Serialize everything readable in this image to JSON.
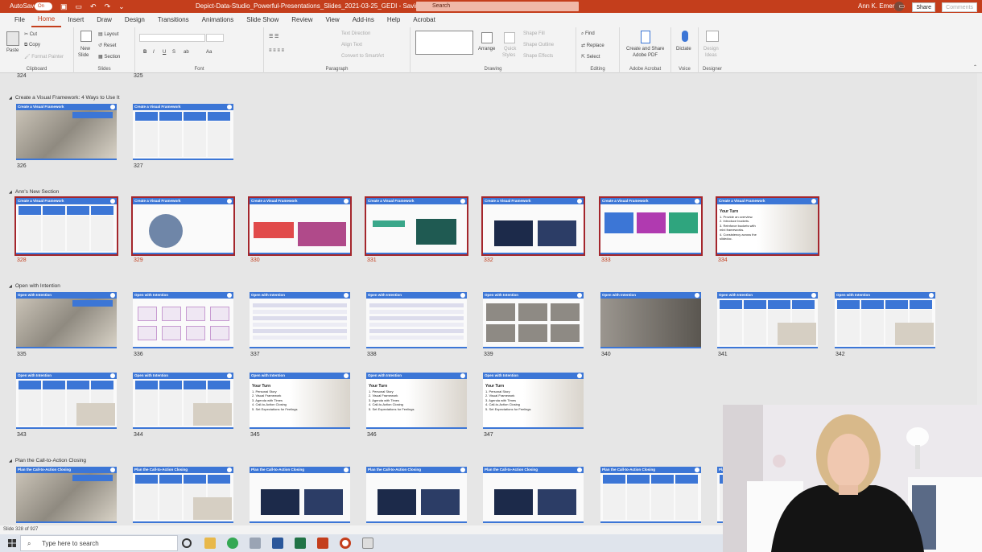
{
  "title_bar": {
    "autosave_label": "AutoSave",
    "autosave_state": "On",
    "document_title": "Depict-Data-Studio_Powerful-Presentations_Slides_2021-03-25_GEDI  -  Saving  ·",
    "search_placeholder": "Search",
    "user_name": "Ann K. Emery"
  },
  "menu": {
    "tabs": [
      "File",
      "Home",
      "Insert",
      "Draw",
      "Design",
      "Transitions",
      "Animations",
      "Slide Show",
      "Review",
      "View",
      "Add-ins",
      "Help",
      "Acrobat"
    ],
    "active_tab": "Home",
    "share_label": "Share",
    "comments_label": "Comments"
  },
  "ribbon": {
    "clipboard": {
      "paste": "Paste",
      "cut": "Cut",
      "copy": "Copy",
      "format_painter": "Format Painter",
      "label": "Clipboard"
    },
    "slides": {
      "new_slide": "New",
      "new_slide2": "Slide",
      "layout": "Layout",
      "reset": "Reset",
      "section": "Section",
      "label": "Slides"
    },
    "font": {
      "label": "Font",
      "bold": "B",
      "italic": "I",
      "underline": "U",
      "strike": "S",
      "spacing": "ab",
      "case": "Aa"
    },
    "paragraph": {
      "text_direction": "Text Direction",
      "align_text": "Align Text",
      "smartart": "Convert to SmartArt",
      "label": "Paragraph"
    },
    "drawing": {
      "arrange": "Arrange",
      "quick_styles": "Quick",
      "quick_styles2": "Styles",
      "shape_fill": "Shape Fill",
      "shape_outline": "Shape Outline",
      "shape_effects": "Shape Effects",
      "label": "Drawing"
    },
    "editing": {
      "find": "Find",
      "replace": "Replace",
      "select": "Select",
      "label": "Editing"
    },
    "acrobat": {
      "create_share": "Create and Share",
      "create_share2": "Adobe PDF",
      "label": "Adobe Acrobat"
    },
    "voice": {
      "dictate": "Dictate",
      "label": "Voice"
    },
    "designer": {
      "design_ideas": "Design",
      "design_ideas2": "Ideas",
      "label": "Designer"
    }
  },
  "top_numbers": [
    "324",
    "325"
  ],
  "sections": [
    {
      "name": "Create a Visual Framework: 4 Ways to Use It",
      "slides": [
        {
          "num": "326",
          "title": "Create a Visual Framework",
          "style": "photo"
        },
        {
          "num": "327",
          "title": "Create a Visual Framework",
          "style": "panels"
        }
      ]
    },
    {
      "name": "Ann's New Section",
      "slides": [
        {
          "num": "328",
          "title": "Create a Visual Framework",
          "style": "panels"
        },
        {
          "num": "329",
          "title": "Create a Visual Framework",
          "style": "circle"
        },
        {
          "num": "330",
          "title": "Create a Visual Framework",
          "style": "images"
        },
        {
          "num": "331",
          "title": "Create a Visual Framework",
          "style": "video"
        },
        {
          "num": "332",
          "title": "Create a Visual Framework",
          "style": "dark"
        },
        {
          "num": "333",
          "title": "Create a Visual Framework",
          "style": "colors"
        },
        {
          "num": "334",
          "title": "Create a Visual Framework",
          "style": "yourturn",
          "turn_title": "Your Turn",
          "turn_items": [
            "1.  Provide an overview.",
            "2.  Introduce buckets.",
            "3.  Reinforce buckets with",
            "     mini frameworks.",
            "4.  Consistency across the",
            "     slidedoc."
          ]
        }
      ]
    },
    {
      "name": "Open with Intention",
      "slides": [
        {
          "num": "335",
          "title": "Open with Intention",
          "style": "photo"
        },
        {
          "num": "336",
          "title": "Open with Intention",
          "style": "charts"
        },
        {
          "num": "337",
          "title": "Open with Intention",
          "style": "table"
        },
        {
          "num": "338",
          "title": "Open with Intention",
          "style": "table"
        },
        {
          "num": "339",
          "title": "Open with Intention",
          "style": "grid"
        },
        {
          "num": "340",
          "title": "Open with Intention",
          "style": "darkphoto"
        },
        {
          "num": "341",
          "title": "Open with Intention",
          "style": "pencil"
        },
        {
          "num": "342",
          "title": "Open with Intention",
          "style": "pencil"
        },
        {
          "num": "343",
          "title": "Open with Intention",
          "style": "pencil"
        },
        {
          "num": "344",
          "title": "Open with Intention",
          "style": "pencil"
        },
        {
          "num": "345",
          "title": "Open with Intention",
          "style": "yourturn",
          "turn_title": "Your Turn",
          "turn_items": [
            "1.  Personal Story",
            "2.  Visual Framework",
            "3.  Agenda with Times",
            "4.  Call-to-Action Closing",
            "5.  Set Expectations for Feelings"
          ]
        },
        {
          "num": "346",
          "title": "Open with Intention",
          "style": "yourturn",
          "turn_title": "Your Turn",
          "turn_items": [
            "1.  Personal Story",
            "2.  Visual Framework",
            "3.  Agenda with Times",
            "4.  Call-to-Action Closing",
            "5.  Set Expectations for Feelings"
          ]
        },
        {
          "num": "347",
          "title": "Open with Intention",
          "style": "yourturn",
          "turn_title": "Your Turn",
          "turn_items": [
            "1.  Personal Story",
            "2.  Visual Framework",
            "3.  Agenda with Times",
            "4.  Call-to-Action Closing",
            "5.  Set Expectations for Feelings"
          ]
        }
      ]
    },
    {
      "name": "Plan the Call-to-Action Closing",
      "slides": [
        {
          "num": "",
          "title": "Plan the Call-to-Action Closing",
          "style": "photo"
        },
        {
          "num": "",
          "title": "Plan the Call-to-Action Closing",
          "style": "pencil"
        },
        {
          "num": "",
          "title": "Plan the Call-to-Action Closing",
          "style": "dark"
        },
        {
          "num": "",
          "title": "Plan the Call-to-Action Closing",
          "style": "dark"
        },
        {
          "num": "",
          "title": "Plan the Call-to-Action Closing",
          "style": "dark"
        },
        {
          "num": "",
          "title": "Plan the Call-to-Action Closing",
          "style": "panels"
        },
        {
          "num": "",
          "title": "Plan the Call-to-Action Closing",
          "style": "panels"
        }
      ]
    }
  ],
  "status_bar": {
    "slide_counter": "Slide 328 of 927"
  },
  "taskbar": {
    "search_placeholder": "Type here to search"
  },
  "colors": {
    "accent": "#c43e1c",
    "slide_blue": "#3c76d6",
    "selection": "#a4262c"
  }
}
